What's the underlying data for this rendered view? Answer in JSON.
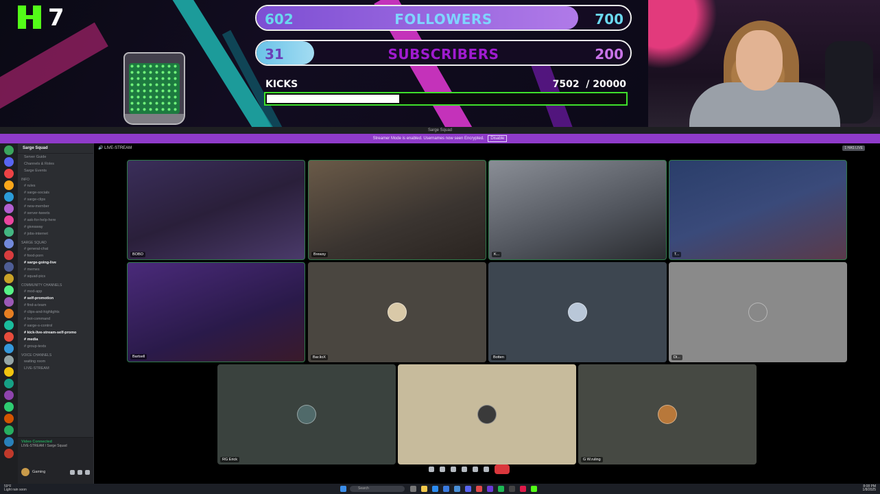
{
  "overlay": {
    "kick_count": "7",
    "followers": {
      "current": "602",
      "title": "FOLLOWERS",
      "target": "700",
      "progress": 0.86
    },
    "subscribers": {
      "current": "31",
      "title": "SUBSCRIBERS",
      "target": "200",
      "progress": 0.155
    },
    "kicks": {
      "label": "KICKS",
      "value": "7502  / 20000",
      "progress": 0.375
    }
  },
  "discord": {
    "title": "Sarge Squad",
    "notice": "Streamer Mode is enabled. Usernames now seen Encrypted.",
    "notice_button": "Disable",
    "server_name": "Sarge Squad",
    "channels": [
      {
        "type": "item",
        "label": "Server Guide"
      },
      {
        "type": "item",
        "label": "Channels & Roles"
      },
      {
        "type": "item",
        "label": "Sarge Events"
      },
      {
        "type": "cat",
        "label": "info"
      },
      {
        "type": "item",
        "label": "# rules"
      },
      {
        "type": "item",
        "label": "# sarge-socials"
      },
      {
        "type": "item",
        "label": "# sarge-clips"
      },
      {
        "type": "item",
        "label": "# new-member"
      },
      {
        "type": "item",
        "label": "# server-tweets"
      },
      {
        "type": "item",
        "label": "# ask-for-help-here"
      },
      {
        "type": "item",
        "label": "# giveaway"
      },
      {
        "type": "item",
        "label": "# jobs-internet"
      },
      {
        "type": "cat",
        "label": "SARGE SQUAD"
      },
      {
        "type": "item",
        "label": "# general-chat"
      },
      {
        "type": "item",
        "label": "# food-porn"
      },
      {
        "type": "item",
        "label": "# sarge-going-live",
        "active": true
      },
      {
        "type": "item",
        "label": "# memes"
      },
      {
        "type": "item",
        "label": "# squad-pics"
      },
      {
        "type": "cat",
        "label": "community channels"
      },
      {
        "type": "item",
        "label": "# mod-app"
      },
      {
        "type": "item",
        "label": "# self-promotion",
        "active": true
      },
      {
        "type": "item",
        "label": "# find-a-team"
      },
      {
        "type": "item",
        "label": "# clips-and-highlights"
      },
      {
        "type": "item",
        "label": "# bot-command"
      },
      {
        "type": "item",
        "label": "# sarge-s-control"
      },
      {
        "type": "item",
        "label": "# kick-live-stream-self-promo",
        "active": true
      },
      {
        "type": "item",
        "label": "# media",
        "active": true
      },
      {
        "type": "item",
        "label": "# group-texts"
      },
      {
        "type": "cat",
        "label": "Voice Channels"
      },
      {
        "type": "item",
        "label": "waiting room"
      },
      {
        "type": "item",
        "label": "LIVE-STREAM"
      }
    ],
    "voice_status": "Video Connected",
    "voice_channel": "LIVE-STREAM / Sarge Squad",
    "user_name": "Gaming",
    "stage_title": "LIVE-STREAM",
    "stage_badge": "1 HAS LIVE",
    "participants": [
      {
        "name": "BOBO"
      },
      {
        "name": "Brewsy"
      },
      {
        "name": "K..."
      },
      {
        "name": "T..."
      },
      {
        "name": "Bartsell"
      },
      {
        "name": "Bar.lioX"
      },
      {
        "name": "Botten"
      },
      {
        "name": "Di..."
      },
      {
        "name": "RG Erick"
      },
      {
        "name": ""
      },
      {
        "name": "G W.ruling"
      }
    ]
  },
  "taskbar": {
    "weather": "59°F",
    "weather_sub": "Light rain soon",
    "search_placeholder": "Search",
    "time": "8:08 PM",
    "date": "1/8/2025"
  }
}
